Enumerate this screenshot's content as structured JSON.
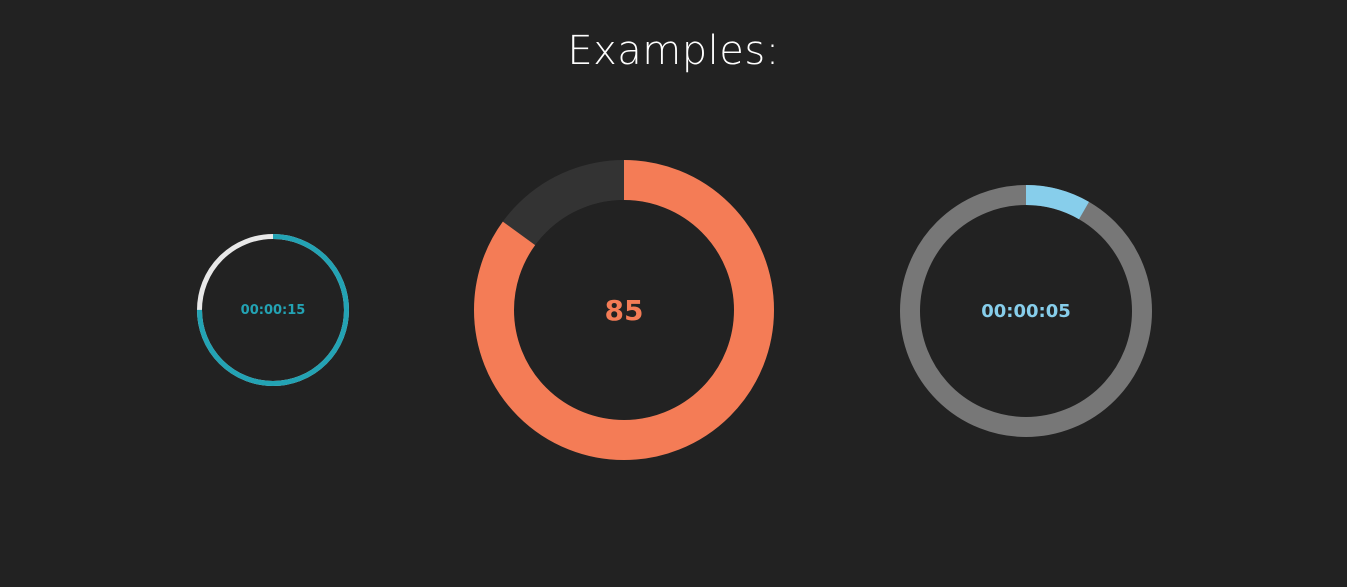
{
  "header": {
    "title": "Examples:"
  },
  "dials": [
    {
      "id": "timer-small",
      "label": "00:00:15",
      "progress": 0.75,
      "track_color": "#e8e8e8",
      "progress_color": "#23a3b4",
      "label_color": "#23a3b4"
    },
    {
      "id": "percent",
      "label": "85",
      "progress": 0.85,
      "track_color": "#333333",
      "progress_color": "#f47c56",
      "label_color": "#f47c56"
    },
    {
      "id": "timer-large",
      "label": "00:00:05",
      "progress": 0.0833,
      "track_color": "#777777",
      "progress_color": "#87ceeb",
      "label_color": "#87ceeb"
    }
  ]
}
